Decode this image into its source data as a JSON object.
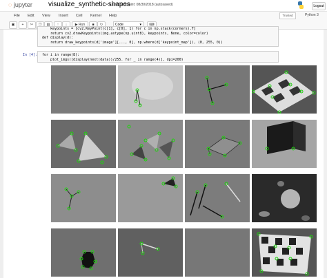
{
  "header": {
    "logo_text": "jupyter",
    "notebook_title": "visualize_synthetic-shapes",
    "checkpoint": "Last Checkpoint: 08/30/2018",
    "autosave": "(autosaved)",
    "logout_label": "Logout"
  },
  "menu": [
    "File",
    "Edit",
    "View",
    "Insert",
    "Cell",
    "Kernel",
    "Help"
  ],
  "status": {
    "trusted": "Trusted",
    "kernel_name": "Python 3"
  },
  "toolbar": {
    "run_label": "Run",
    "cell_type": "Code"
  },
  "cells": {
    "cell3_lines": [
      "    keypoints = [cv2.KeyPoint(c[1], c[0], 1) for c in np.stack(corners).T]",
      "    return cv2.drawKeypoints(img.astype(np.uint8), keypoints, None, color=color)",
      "def display(d):",
      "    return draw_keypoints(d['image'][..., 0], np.where(d['keypoint_map']), (0, 255, 0))"
    ],
    "cell4_prompt": "In [4]:",
    "cell4_line1": "for i in range(8):",
    "cell4_line2": "    plot_imgs([display(next(data))/255. for _ in range(4)], dpi=200)"
  },
  "output": {
    "grid_rows": 4,
    "grid_cols": 4,
    "keypoint_color": "#1fd40e"
  }
}
